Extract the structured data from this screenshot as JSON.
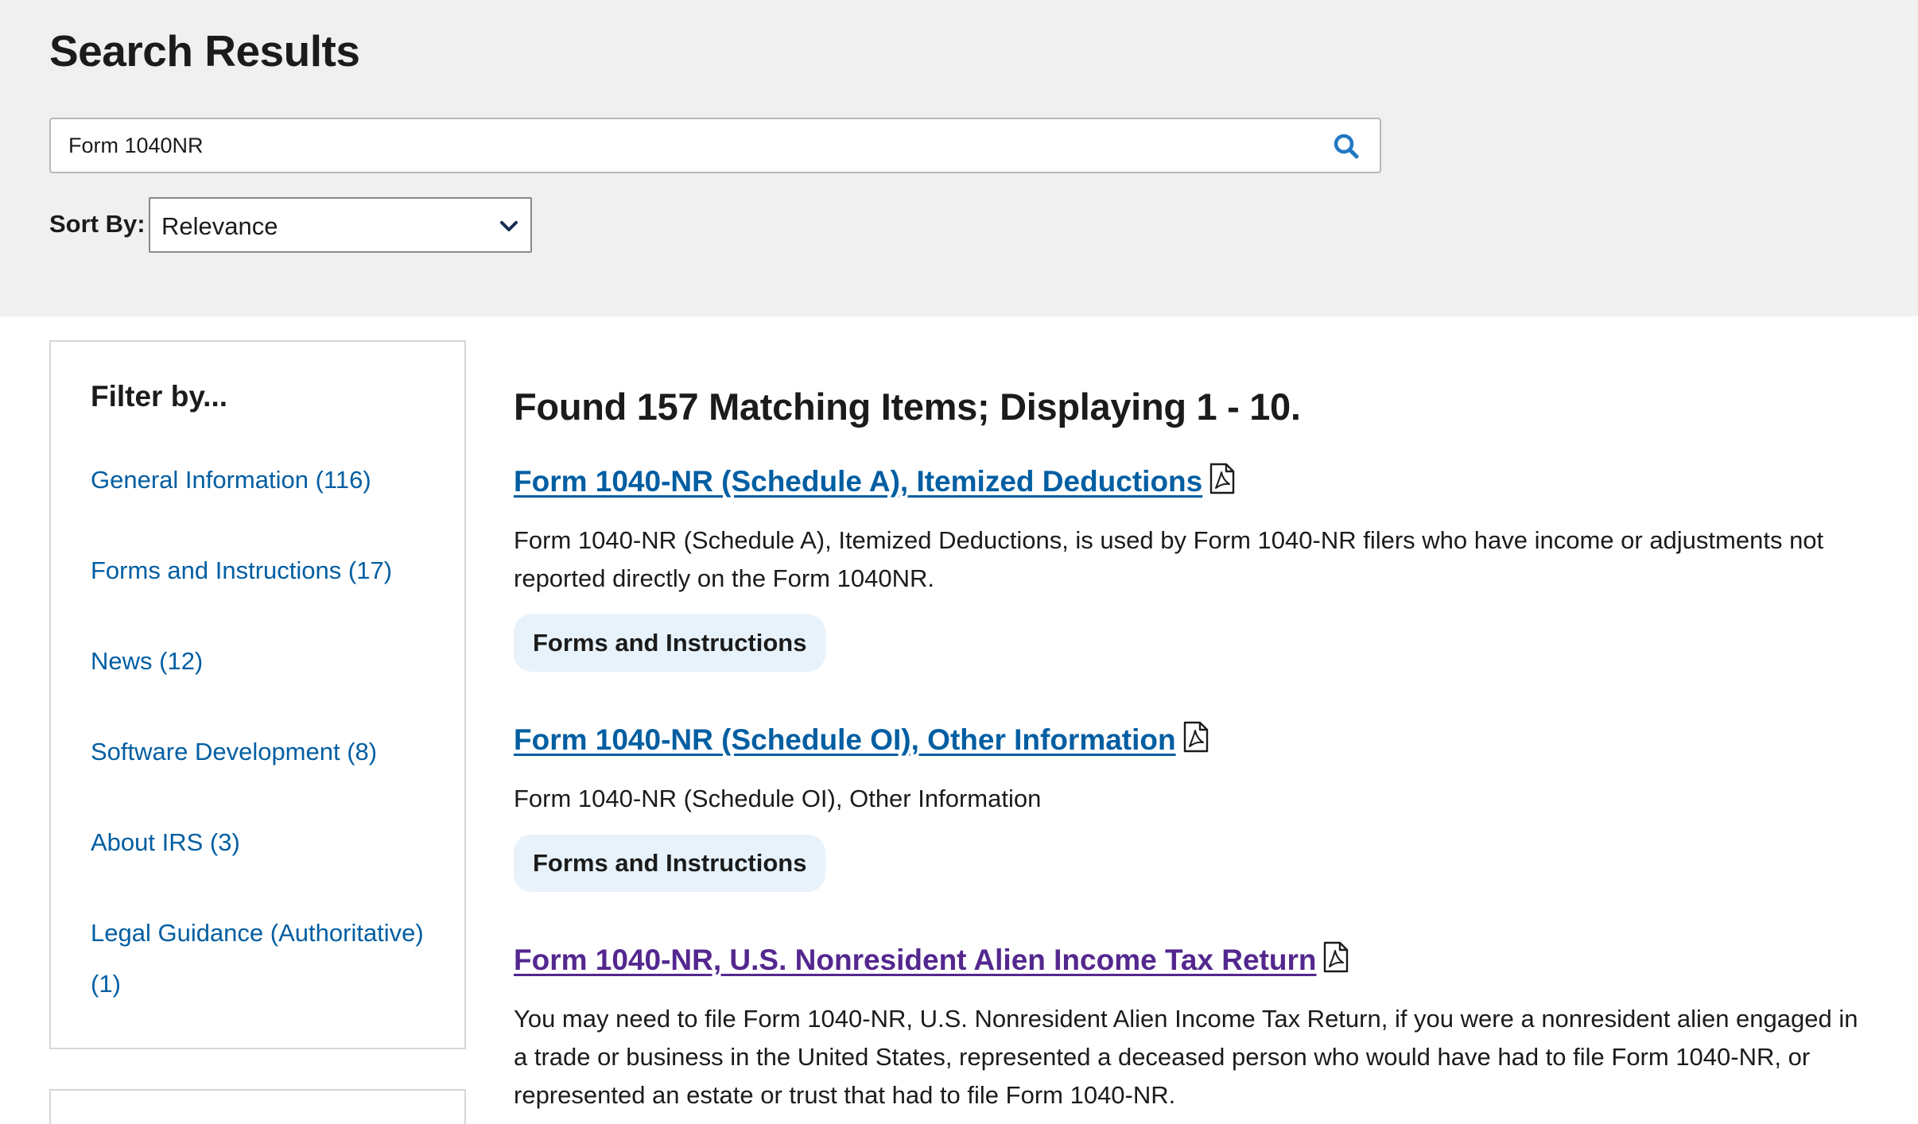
{
  "header": {
    "title": "Search Results"
  },
  "search": {
    "value": "Form 1040NR"
  },
  "sort": {
    "label": "Sort By:",
    "selected": "Relevance"
  },
  "sidebar": {
    "title": "Filter by...",
    "items": [
      {
        "label": "General Information (116)"
      },
      {
        "label": "Forms and Instructions (17)"
      },
      {
        "label": "News (12)"
      },
      {
        "label": "Software Development (8)"
      },
      {
        "label": "About IRS (3)"
      },
      {
        "label": "Legal Guidance (Authoritative) (1)"
      }
    ]
  },
  "results": {
    "summary": "Found 157 Matching Items; Displaying 1 - 10.",
    "items": [
      {
        "title": "Form 1040-NR (Schedule A), Itemized Deductions",
        "description": "Form 1040-NR (Schedule A), Itemized Deductions, is used by Form 1040-NR filers who have income or adjustments not reported directly on the Form 1040NR.",
        "tag": "Forms and Instructions",
        "icon": "pdf-icon"
      },
      {
        "title": "Form 1040-NR (Schedule OI), Other Information",
        "description": "Form 1040-NR (Schedule OI), Other Information",
        "tag": "Forms and Instructions",
        "icon": "pdf-icon"
      },
      {
        "title": "Form 1040-NR, U.S. Nonresident Alien Income Tax Return",
        "description": "You may need to file Form 1040-NR, U.S. Nonresident Alien Income Tax Return, if you were a nonresident alien engaged in a trade or business in the United States, represented a deceased person who would have had to file Form 1040-NR, or represented an estate or trust that had to file Form 1040-NR.",
        "icon": "pdf-icon",
        "visited": true
      }
    ]
  },
  "colors": {
    "link": "#005ea2",
    "visited_link": "#54278f",
    "tag_background": "#e7f2fb",
    "band_background": "#f0f0f0"
  }
}
